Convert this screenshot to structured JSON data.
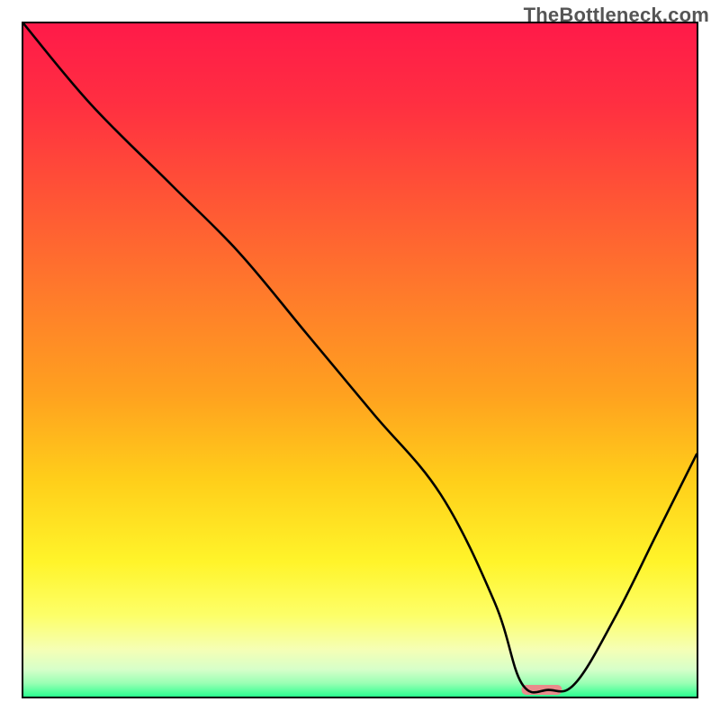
{
  "watermark": "TheBottleneck.com",
  "chart_data": {
    "type": "line",
    "title": "",
    "xlabel": "",
    "ylabel": "",
    "xlim": [
      0,
      100
    ],
    "ylim": [
      0,
      100
    ],
    "series": [
      {
        "name": "bottleneck-curve",
        "x": [
          0,
          10,
          22,
          32,
          42,
          52,
          62,
          70,
          74,
          78,
          82,
          88,
          94,
          100
        ],
        "y": [
          100,
          88,
          76,
          66,
          54,
          42,
          30,
          14,
          2,
          1,
          2,
          12,
          24,
          36
        ]
      }
    ],
    "marker": {
      "name": "target-marker",
      "x_range": [
        74,
        80
      ],
      "y": 1,
      "color": "#ea8b8b"
    },
    "gradient_stops": [
      {
        "offset": 0,
        "color": "#ff1a49"
      },
      {
        "offset": 12,
        "color": "#ff2f41"
      },
      {
        "offset": 25,
        "color": "#ff5236"
      },
      {
        "offset": 40,
        "color": "#ff7a2b"
      },
      {
        "offset": 55,
        "color": "#ffa11f"
      },
      {
        "offset": 68,
        "color": "#ffcf1a"
      },
      {
        "offset": 80,
        "color": "#fff42a"
      },
      {
        "offset": 88,
        "color": "#fdff69"
      },
      {
        "offset": 93,
        "color": "#f5ffb5"
      },
      {
        "offset": 96,
        "color": "#d6ffc9"
      },
      {
        "offset": 98,
        "color": "#9affb4"
      },
      {
        "offset": 100,
        "color": "#2aff8f"
      }
    ]
  }
}
